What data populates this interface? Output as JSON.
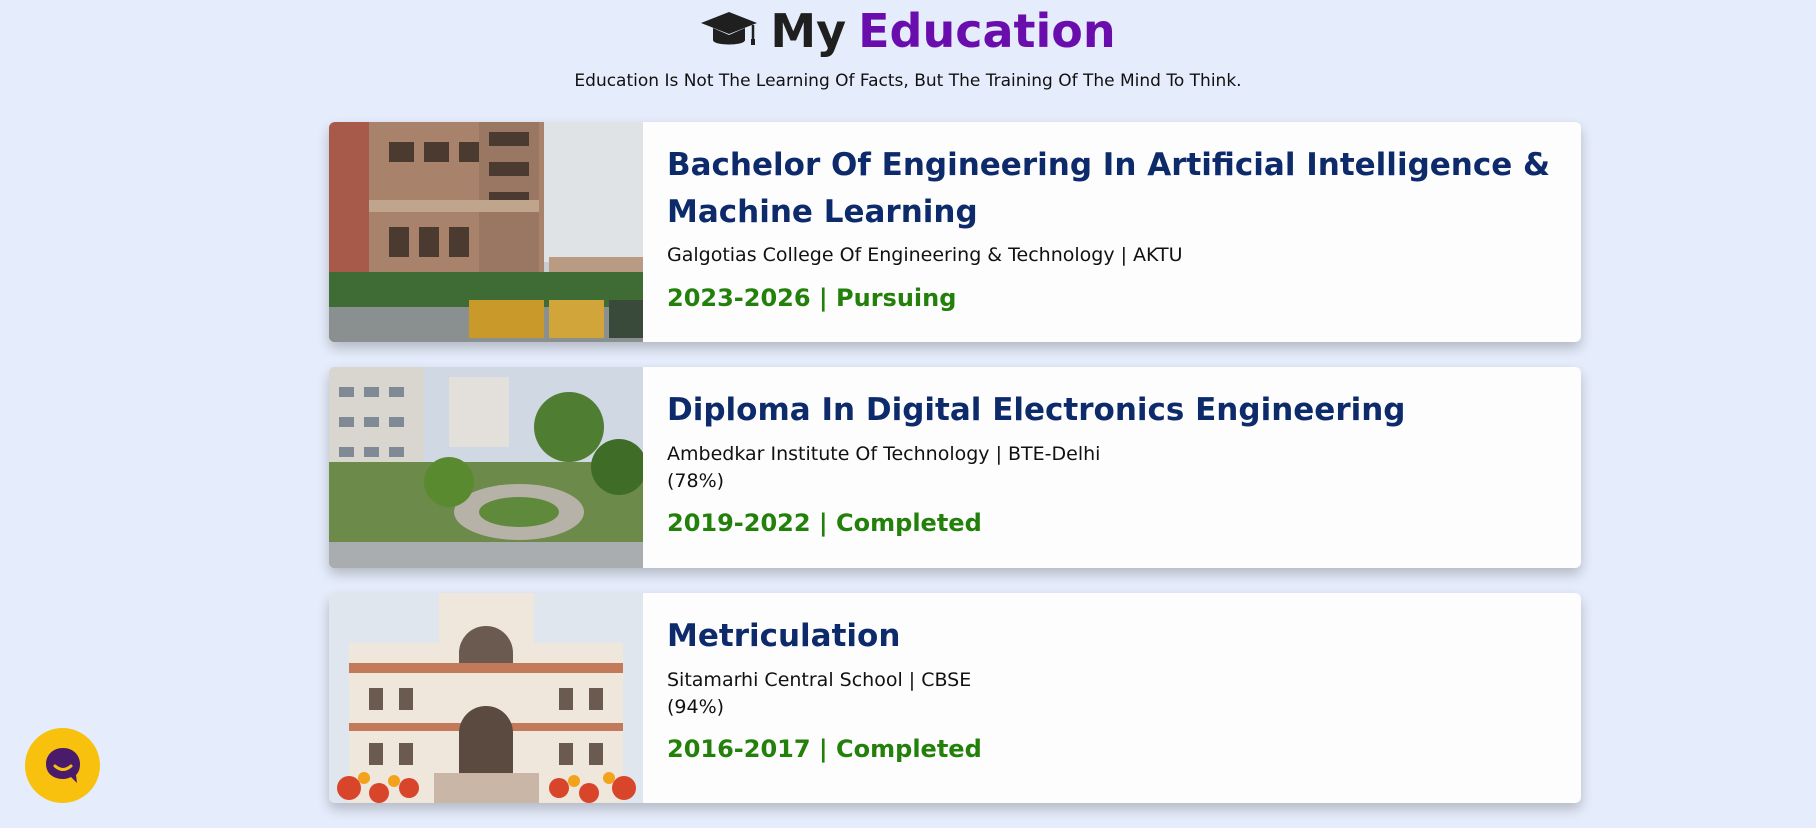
{
  "header": {
    "title_part1": "My",
    "title_part2": "Education",
    "icon": "graduation-cap-icon",
    "subtitle": "Education Is Not The Learning Of Facts, But The Training Of The Mind To Think.",
    "accent_color": "#6a0dad"
  },
  "education": [
    {
      "title": "Bachelor Of Engineering In Artificial Intelligence & Machine Learning",
      "institution": "Galgotias College Of Engineering & Technology | AKTU",
      "score": "",
      "dates": "2023-2026 | Pursuing",
      "image": "campus-building-photo"
    },
    {
      "title": "Diploma In Digital Electronics Engineering",
      "institution": "Ambedkar Institute Of Technology | BTE-Delhi",
      "score": "(78%)",
      "dates": "2019-2022 | Completed",
      "image": "campus-garden-photo"
    },
    {
      "title": "Metriculation",
      "institution": "Sitamarhi Central School | CBSE",
      "score": "(94%)",
      "dates": "2016-2017 | Completed",
      "image": "school-building-photo"
    }
  ],
  "chat_widget": {
    "icon": "chat-bubble-icon",
    "color": "#f7c10e"
  }
}
